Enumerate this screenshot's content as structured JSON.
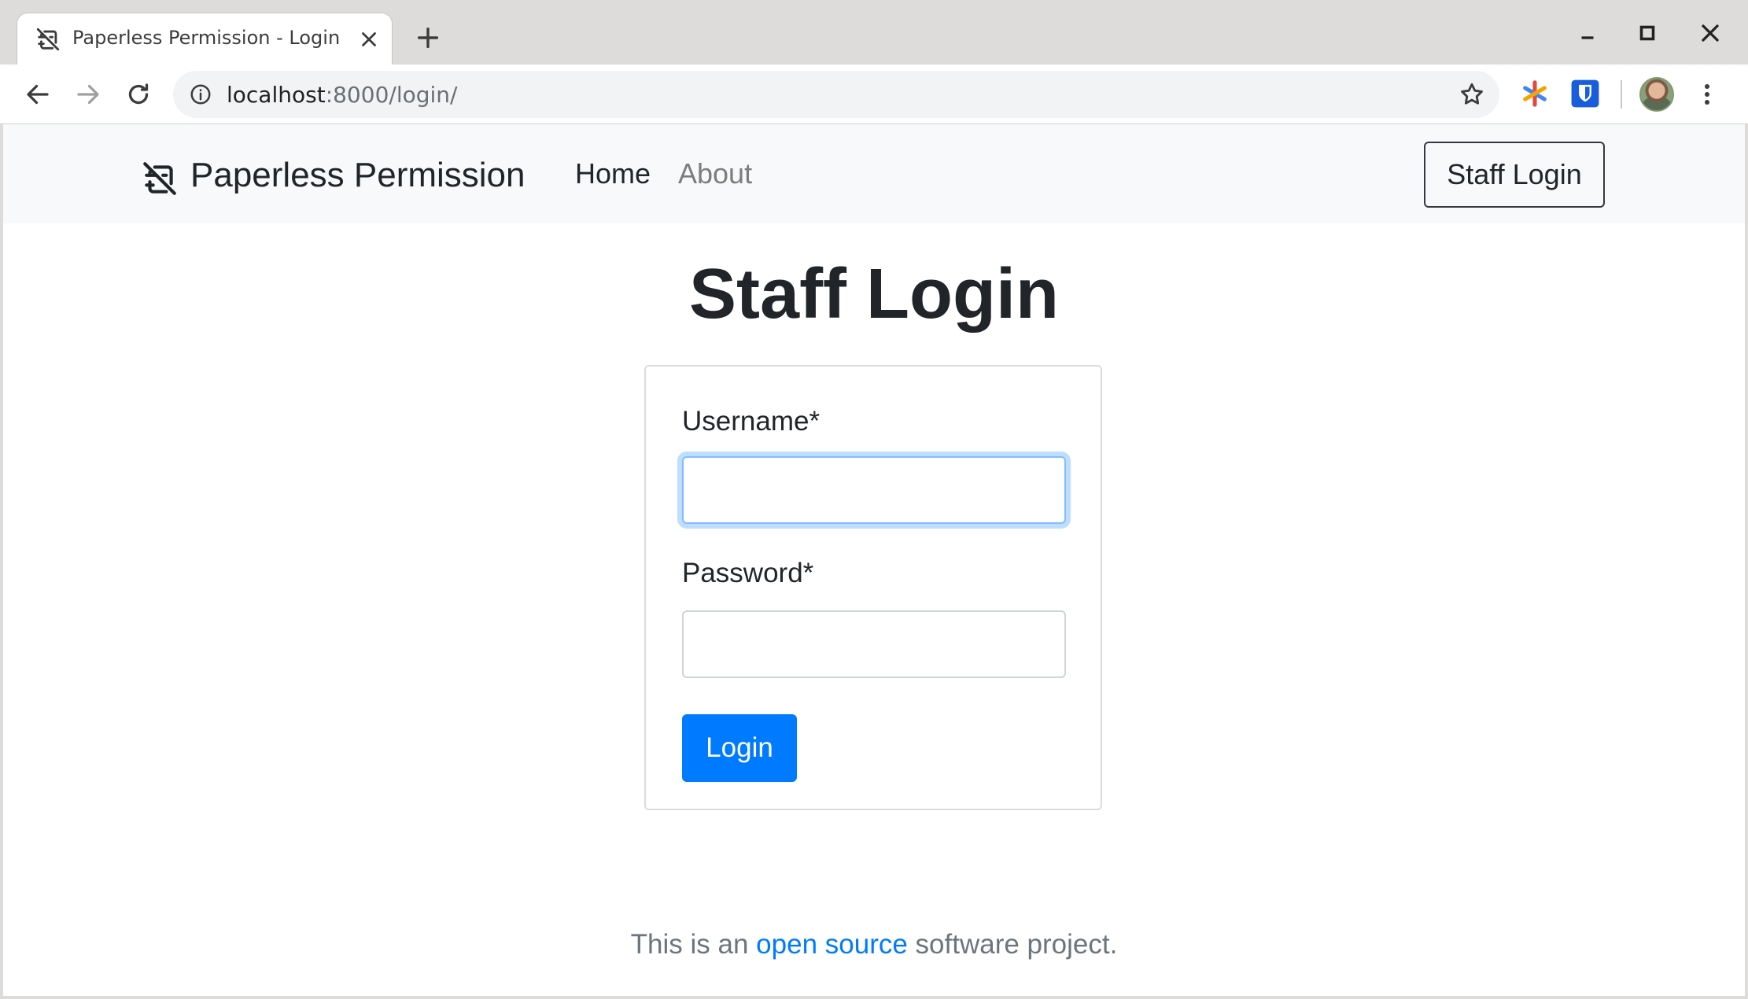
{
  "browser": {
    "tab_title": "Paperless Permission - Login",
    "url_host": "localhost",
    "url_path": ":8000/login/"
  },
  "site": {
    "brand": "Paperless Permission",
    "nav": {
      "home": "Home",
      "about": "About"
    },
    "staff_login_button": "Staff Login"
  },
  "page": {
    "heading": "Staff Login",
    "form": {
      "username_label": "Username*",
      "username_value": "",
      "password_label": "Password*",
      "password_value": "",
      "submit_label": "Login"
    }
  },
  "footer": {
    "prefix": "This is an ",
    "link_text": "open source",
    "suffix": " software project."
  },
  "colors": {
    "primary": "#007bff",
    "navbar_bg": "#f8f9fa",
    "text": "#212529",
    "muted": "#6c757d"
  }
}
